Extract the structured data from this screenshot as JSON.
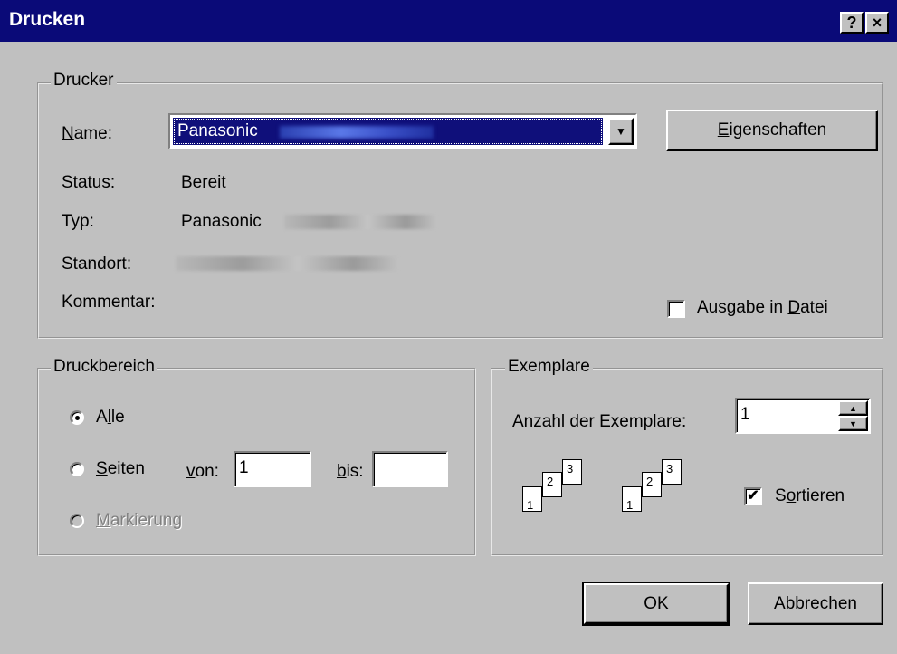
{
  "title": "Drucken",
  "titlebar": {
    "help_label": "?",
    "close_label": "×"
  },
  "printer": {
    "group_label": "Drucker",
    "name_label_u": "N",
    "name_label_rest": "ame:",
    "name_value": "Panasonic",
    "properties_u": "E",
    "properties_rest": "igenschaften",
    "status_label": "Status:",
    "status_value": "Bereit",
    "type_label": "Typ:",
    "type_value": "Panasonic",
    "location_label": "Standort:",
    "comment_label": "Kommentar:",
    "print_to_file_pre": "Ausgabe in ",
    "print_to_file_u": "D",
    "print_to_file_post": "atei",
    "print_to_file_checked": false
  },
  "range": {
    "group_label": "Druckbereich",
    "all_pre": "A",
    "all_u": "l",
    "all_post": "le",
    "pages_u": "S",
    "pages_rest": "eiten",
    "from_u": "v",
    "from_rest": "on:",
    "from_value": "1",
    "to_u": "b",
    "to_rest": "is:",
    "to_value": "",
    "selection_u": "M",
    "selection_rest": "arkierung",
    "selected": "all"
  },
  "copies": {
    "group_label": "Exemplare",
    "count_pre": "An",
    "count_u": "z",
    "count_post": "ahl der Exemplare:",
    "count_value": "1",
    "page_numbers": [
      "1",
      "2",
      "3"
    ],
    "collate_pre": "S",
    "collate_u": "o",
    "collate_post": "rtieren",
    "collate_checked": true
  },
  "buttons": {
    "ok": "OK",
    "cancel": "Abbrechen"
  }
}
